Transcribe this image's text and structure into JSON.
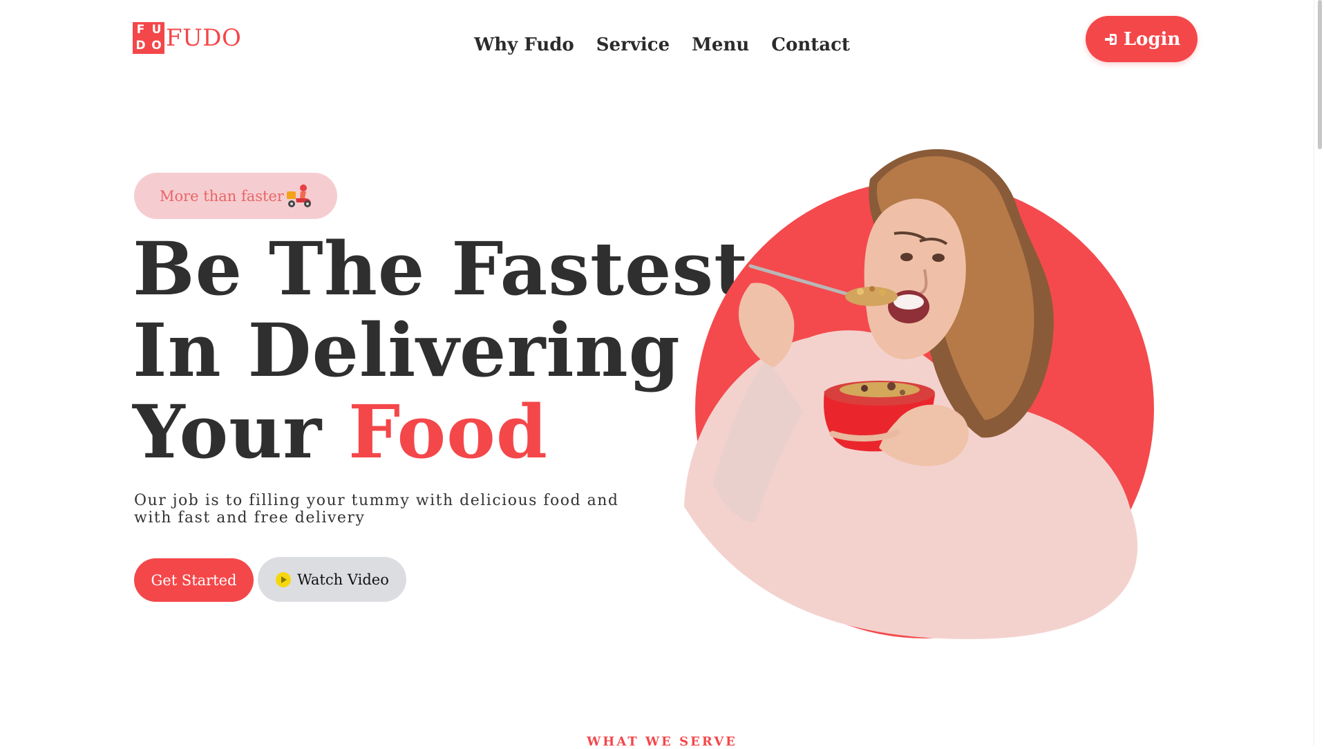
{
  "brand": {
    "mark_letters": [
      "F",
      "U",
      "D",
      "O"
    ],
    "name": "FUDO",
    "accent_color": "#f4474a"
  },
  "nav": {
    "items": [
      "Why Fudo",
      "Service",
      "Menu",
      "Contact"
    ]
  },
  "header": {
    "login_label": "Login",
    "login_icon": "login-icon"
  },
  "hero": {
    "badge_text": "More than faster",
    "badge_icon": "delivery-scooter-icon",
    "title_line1": "Be The Fastest",
    "title_line2": "In Delivering",
    "title_line3_prefix": "Your ",
    "title_line3_accent": "Food",
    "subtitle": "Our job is to filling your tummy with delicious food and with fast and free delivery",
    "primary_button": "Get Started",
    "secondary_button": "Watch Video",
    "secondary_icon": "play-icon",
    "image_icon": "woman-eating-cereal-image"
  },
  "next_section": {
    "label": "WHAT WE SERVE"
  },
  "colors": {
    "primary": "#f4474a",
    "badge_bg": "#f5cdd0",
    "secondary_button_bg": "#dcdde1",
    "text_dark": "#2f2f2f"
  }
}
